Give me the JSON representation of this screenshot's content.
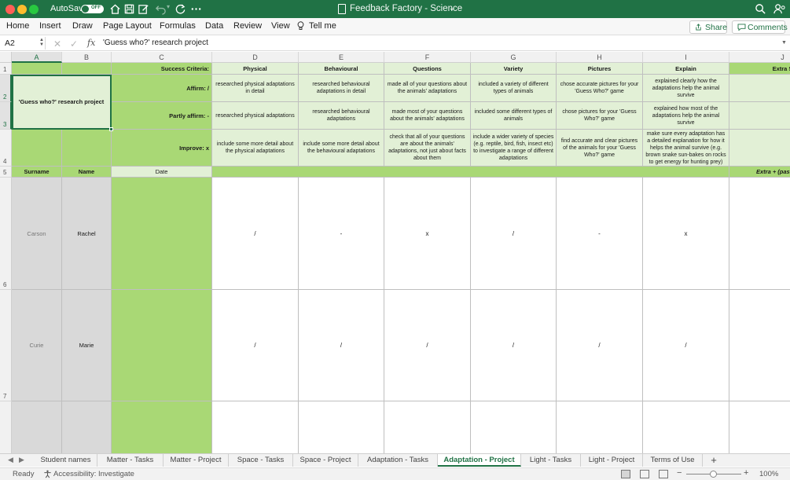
{
  "titlebar": {
    "autosave_label": "AutoSave",
    "autosave_state": "OFF",
    "doc_title": "Feedback Factory - Science",
    "doc_chevron": "⌄"
  },
  "ribbon": {
    "tabs": [
      "Home",
      "Insert",
      "Draw",
      "Page Layout",
      "Formulas",
      "Data",
      "Review",
      "View"
    ],
    "tell_me": "Tell me",
    "share_label": "Share",
    "comments_label": "Comments"
  },
  "formula_bar": {
    "name_box": "A2",
    "fx": "fx",
    "content": "'Guess who?' research project"
  },
  "columns": [
    "A",
    "B",
    "C",
    "D",
    "E",
    "F",
    "G",
    "H",
    "I",
    "J"
  ],
  "rows": [
    "1",
    "2",
    "3",
    "4",
    "5",
    "6",
    "7"
  ],
  "sheet": {
    "success_criteria_label": "Success Criteria:",
    "project_title": "'Guess who?' research project",
    "affirm_label": "Affirm: /",
    "partly_label": "Partly affirm: -",
    "improve_label": "Improve: x",
    "criteria": [
      {
        "name": "Physical",
        "affirm": "researched physical adaptations in detail",
        "partly": "researched physical adaptations",
        "improve": "include some more detail about the physical adaptations"
      },
      {
        "name": "Behavioural",
        "affirm": "researched behavioural adaptations in detail",
        "partly": "researched behavioural adaptations",
        "improve": "include some more detail about the behavioural adaptations"
      },
      {
        "name": "Questions",
        "affirm": "made all of your questions about the animals' adaptations",
        "partly": "made most of your questions about the animals' adaptations",
        "improve": "check that all of your questions are about the animals' adaptations, not just about facts about them"
      },
      {
        "name": "Variety",
        "affirm": "included a variety of different types of animals",
        "partly": "included some different types of animals",
        "improve": "include a wider variety of species (e.g. reptile, bird, fish, insect etc) to investigate a range of different adaptations"
      },
      {
        "name": "Pictures",
        "affirm": "chose accurate pictures for your 'Guess Who?' game",
        "partly": "chose pictures for your 'Guess Who?' game",
        "improve": "find accurate and clear pictures of the animals for your 'Guess Who?' game"
      },
      {
        "name": "Explain",
        "affirm": "explained clearly how the adaptations help the animal survive",
        "partly": "explained how most of the adaptations help the animal survive",
        "improve": "make sure every adaptation has a detailed explanation for how it helps the animal survive (e.g. brown snake sun-bakes on rocks to get energy for hunting prey)"
      }
    ],
    "extra_header": "Extra S",
    "extra_sub": "Extra + (pass",
    "col_surname": "Surname",
    "col_name": "Name",
    "col_date": "Date",
    "students": [
      {
        "surname": "Carson",
        "name": "Rachel",
        "marks": [
          "/",
          "-",
          "x",
          "/",
          "-",
          "x"
        ]
      },
      {
        "surname": "Curie",
        "name": "Marie",
        "marks": [
          "/",
          "/",
          "/",
          "/",
          "/",
          "/"
        ]
      }
    ]
  },
  "sheet_tabs": [
    "Student names",
    "Matter - Tasks",
    "Matter - Project",
    "Space - Tasks",
    "Space - Project",
    "Adaptation - Tasks",
    "Adaptation - Project",
    "Light - Tasks",
    "Light - Project",
    "Terms of Use"
  ],
  "active_sheet": "Adaptation - Project",
  "status": {
    "ready": "Ready",
    "accessibility": "Accessibility: Investigate",
    "zoom": "100%",
    "zoom_minus": "−",
    "zoom_plus": "+"
  },
  "colors": {
    "excel_green": "#207245",
    "header_green": "#a9d875",
    "light_green": "#e2f0d6",
    "name_gray": "#d9d9d9"
  }
}
